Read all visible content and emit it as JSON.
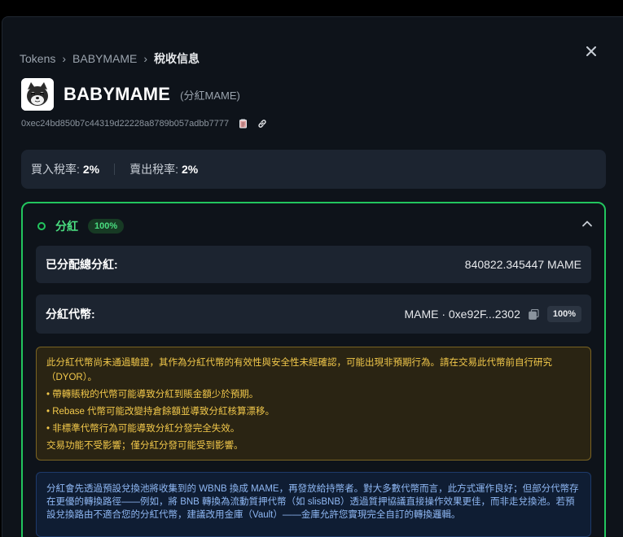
{
  "breadcrumb": {
    "items": [
      "Tokens",
      "BABYMAME",
      "稅收信息"
    ],
    "separator": "›"
  },
  "close_label": "×",
  "token": {
    "name": "BABYMAME",
    "subtitle": "(分紅MAME)",
    "address": "0xec24bd850b7c44319d22228a8789b057adbb7777"
  },
  "tax": {
    "buy_label": "買入稅率:",
    "buy_value": "2%",
    "sell_label": "賣出稅率:",
    "sell_value": "2%"
  },
  "dividend": {
    "title": "分紅",
    "badge": "100%",
    "total_label": "已分配總分紅:",
    "total_value": "840822.345447 MAME",
    "token_label": "分紅代幣:",
    "token_value": "MAME · 0xe92F...2302",
    "token_pct": "100%"
  },
  "warning": {
    "intro": "此分紅代幣尚未通過驗證，其作為分紅代幣的有效性與安全性未經確認，可能出現非預期行為。請在交易此代幣前自行研究（DYOR）。",
    "bullets": [
      "• 帶轉賬稅的代幣可能導致分紅到賬金額少於預期。",
      "• Rebase 代幣可能改變持倉餘額並導致分紅核算漂移。",
      "• 非標準代幣行為可能導致分紅分發完全失效。"
    ],
    "footer": "交易功能不受影響；僅分紅分發可能受到影響。"
  },
  "info": {
    "text": "分紅會先透過預設兌換池將收集到的 WBNB 換成 MAME，再發放給持幣者。對大多數代幣而言，此方式運作良好；但部分代幣存在更優的轉換路徑——例如，將 BNB 轉換為流動質押代幣（如 slisBNB）透過質押協議直接操作效果更佳，而非走兌換池。若預設兌換路由不適合您的分紅代幣，建議改用金庫（Vault）——金庫允許您實現完全自訂的轉換邏輯。"
  },
  "colors": {
    "accent_green": "#22c55e",
    "warning_text": "#f3c94b",
    "info_text": "#8fb8f4"
  },
  "icons": [
    "close-icon",
    "token-avatar",
    "copy-icon",
    "link-icon",
    "chevron-up-icon",
    "copy-icon"
  ]
}
